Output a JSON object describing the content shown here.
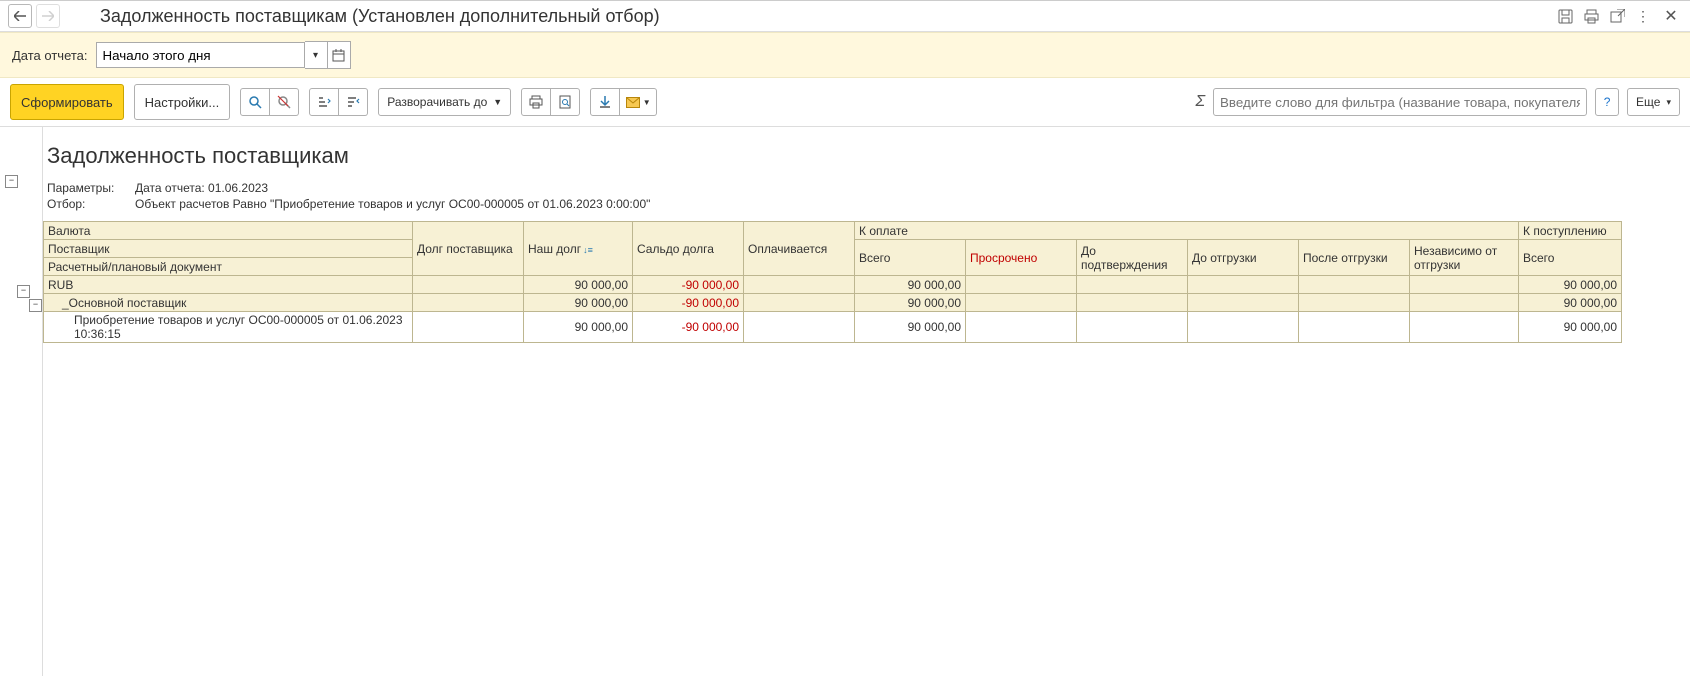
{
  "titlebar": {
    "title": "Задолженность поставщикам (Установлен дополнительный отбор)"
  },
  "filterband": {
    "date_label": "Дата отчета:",
    "date_value": "Начало этого дня"
  },
  "toolbar": {
    "generate": "Сформировать",
    "settings": "Настройки...",
    "expand": "Разворачивать до",
    "more": "Еще",
    "filter_placeholder": "Введите слово для фильтра (название товара, покупателя и пр.)"
  },
  "report": {
    "title": "Задолженность поставщикам",
    "params_label": "Параметры:",
    "params_value": "Дата отчета: 01.06.2023",
    "filter_label": "Отбор:",
    "filter_value": "Объект расчетов Равно \"Приобретение товаров и услуг ОС00-000005 от 01.06.2023 0:00:00\""
  },
  "headers": {
    "c_currency": "Валюта",
    "c_supplier": "Поставщик",
    "c_doc": "Расчетный/плановый документ",
    "c_supplier_debt": "Долг поставщика",
    "c_our_debt": "Наш долг",
    "c_balance": "Сальдо долга",
    "c_paying": "Оплачивается",
    "c_to_pay": "К оплате",
    "c_total": "Всего",
    "c_overdue": "Просрочено",
    "c_before_confirm": "До подтверждения",
    "c_before_ship": "До отгрузки",
    "c_after_ship": "После отгрузки",
    "c_indep": "Независимо от отгрузки",
    "c_to_receive": "К поступлению",
    "c_total2": "Всего"
  },
  "rows": {
    "r0": {
      "name": "RUB",
      "our_debt": "90 000,00",
      "balance": "-90 000,00",
      "to_pay_total": "90 000,00",
      "to_recv": "90 000,00"
    },
    "r1": {
      "name": "_Основной поставщик",
      "our_debt": "90 000,00",
      "balance": "-90 000,00",
      "to_pay_total": "90 000,00",
      "to_recv": "90 000,00"
    },
    "r2": {
      "name": "Приобретение товаров и услуг ОС00-000005 от 01.06.2023 10:36:15",
      "our_debt": "90 000,00",
      "balance": "-90 000,00",
      "to_pay_total": "90 000,00",
      "to_recv": "90 000,00"
    }
  }
}
